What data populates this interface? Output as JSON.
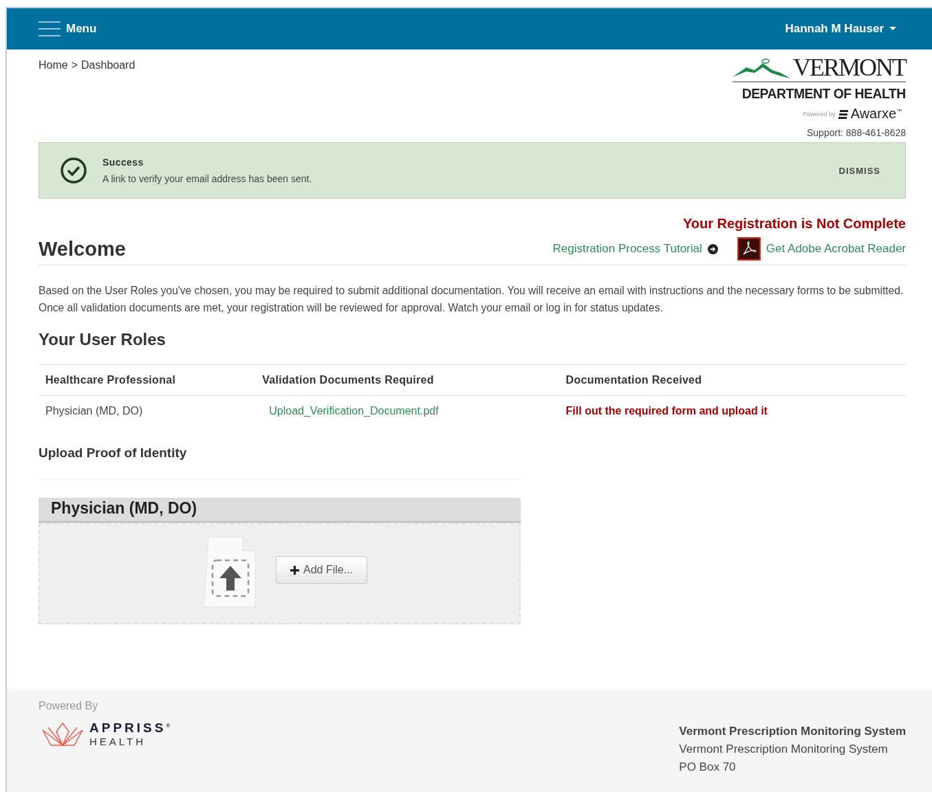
{
  "navbar": {
    "menu_label": "Menu",
    "user_name": "Hannah M Hauser"
  },
  "breadcrumb": [
    {
      "label": "Home"
    },
    {
      "label": ">"
    },
    {
      "label": "Dashboard"
    }
  ],
  "logo": {
    "title": "VERMONT",
    "subtitle": "DEPARTMENT OF HEALTH",
    "powered_by": "Powered by",
    "brand": "Awarxe",
    "brand_mark": "™",
    "support": "Support: 888-461-8628"
  },
  "alert": {
    "title": "Success",
    "message": "A link to verify your email address has been sent.",
    "dismiss": "DISMISS"
  },
  "registration_status": "Your Registration is Not Complete",
  "welcome": {
    "title": "Welcome",
    "tutorial_link": "Registration Process Tutorial",
    "acrobat_link": "Get Adobe Acrobat Reader"
  },
  "intro": "Based on the User Roles you've chosen, you may be required to submit additional documentation. You will receive an email with instructions and the necessary forms to be submitted. Once all validation documents are met, your registration will be reviewed for approval. Watch your email or log in for status updates.",
  "roles": {
    "title": "Your User Roles",
    "columns": [
      "Healthcare Professional",
      "Validation Documents Required",
      "Documentation Received"
    ],
    "rows": [
      {
        "role": "Physician (MD, DO)",
        "document": "Upload_Verification_Document.pdf",
        "status": "Fill out the required form and upload it"
      }
    ]
  },
  "upload": {
    "title": "Upload Proof of Identity",
    "panel_title": "Physician (MD, DO)",
    "button": "Add File..."
  },
  "footer": {
    "powered_by": "Powered By",
    "brand": "APPRISS",
    "brand_mark": "®",
    "brand_sub": "HEALTH",
    "address": [
      "Vermont Prescription Monitoring System",
      "Vermont Prescription Monitoring System",
      "PO Box 70"
    ]
  }
}
